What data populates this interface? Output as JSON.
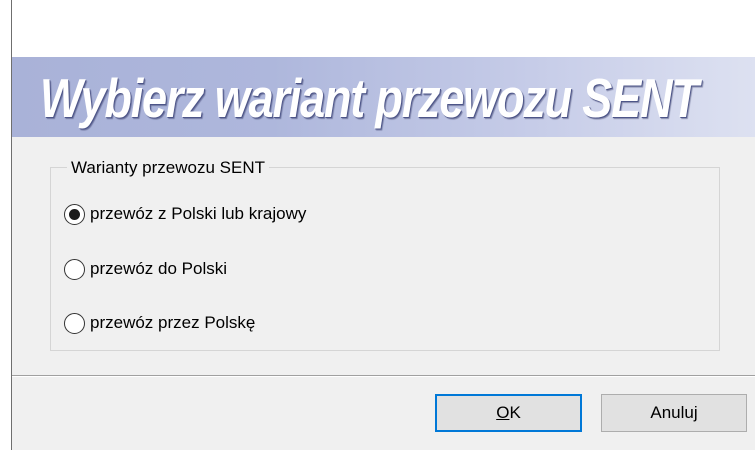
{
  "dialog": {
    "banner_title": "Wybierz wariant przewozu SENT",
    "group_label": "Warianty przewozu SENT",
    "options": [
      {
        "label": "przewóz z Polski lub krajowy",
        "selected": true
      },
      {
        "label": "przewóz do Polski",
        "selected": false
      },
      {
        "label": "przewóz przez Polskę",
        "selected": false
      }
    ],
    "buttons": {
      "ok_mnemonic": "O",
      "ok_rest": "K",
      "cancel_label": "Anuluj"
    }
  },
  "colors": {
    "banner_gradient_start": "#a9b2d8",
    "banner_gradient_end": "#dde1f1",
    "dialog_background": "#f0f0f0",
    "default_button_border": "#0078d7"
  }
}
